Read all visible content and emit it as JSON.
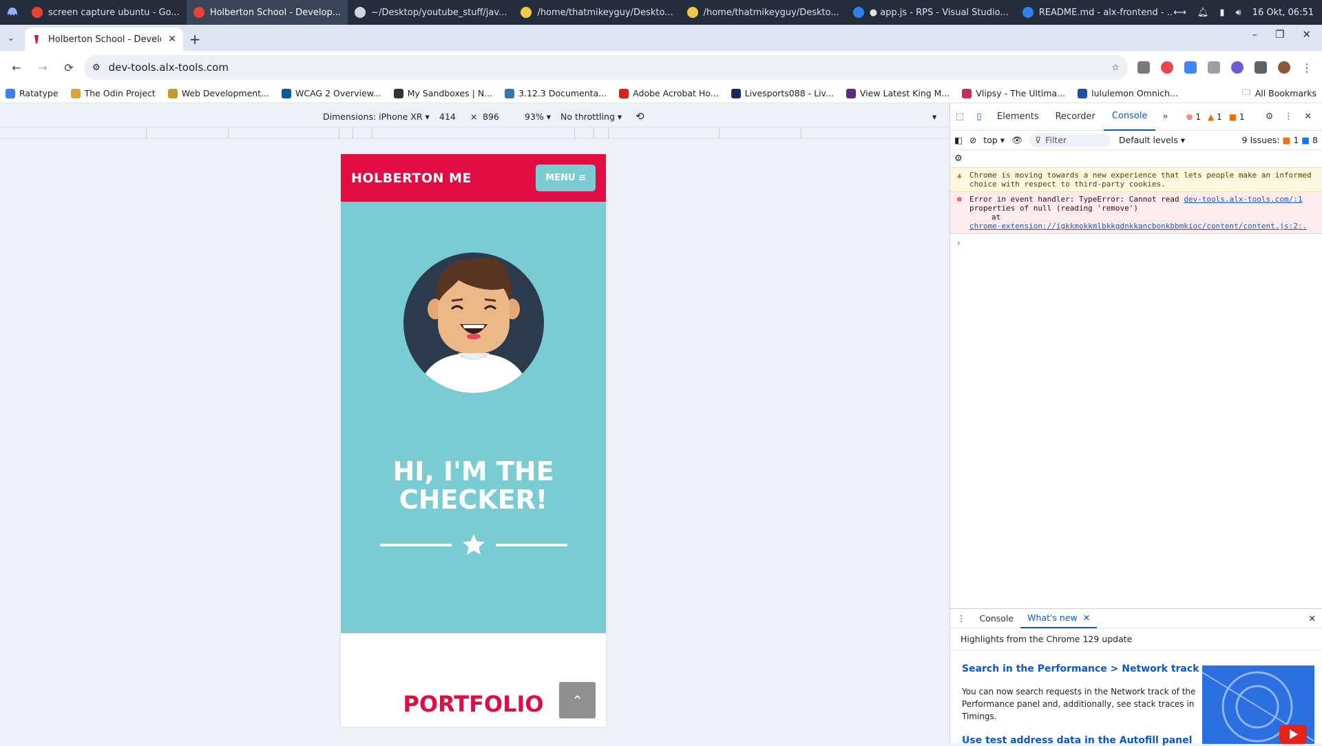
{
  "os": {
    "tasks": [
      {
        "label": "screen capture ubuntu - Go...",
        "color": "#ea4335",
        "active": false
      },
      {
        "label": "Holberton School - Develop...",
        "color": "#ea4335",
        "active": true
      },
      {
        "label": "~/Desktop/youtube_stuff/jav...",
        "color": "#cfd6e0",
        "active": false
      },
      {
        "label": "/home/thatmikeyguy/Deskto...",
        "color": "#f2c94c",
        "active": false
      },
      {
        "label": "/home/thatmikeyguy/Deskto...",
        "color": "#f2c94c",
        "active": false
      },
      {
        "label": "● app.js - RPS - Visual Studio...",
        "color": "#2f80ed",
        "active": false
      },
      {
        "label": "README.md - alx-frontend - ...",
        "color": "#2f80ed",
        "active": false
      }
    ],
    "clock": "16 Okt, 06:51"
  },
  "browser": {
    "tab_title": "Holberton School - Developer",
    "url": "dev-tools.alx-tools.com",
    "bookmarks": [
      {
        "label": "Ratatype",
        "color": "#3b82f6"
      },
      {
        "label": "The Odin Project",
        "color": "#d9a441"
      },
      {
        "label": "Web Development...",
        "color": "#c29b2e"
      },
      {
        "label": "WCAG 2 Overview...",
        "color": "#0a5aa0"
      },
      {
        "label": "My Sandboxes | N...",
        "color": "#333333"
      },
      {
        "label": "3.12.3 Documenta...",
        "color": "#3776ab"
      },
      {
        "label": "Adobe Acrobat Ho...",
        "color": "#d4251c"
      },
      {
        "label": "Livesports088 - Liv...",
        "color": "#1b2a5a"
      },
      {
        "label": "View Latest King M...",
        "color": "#5a2b8a"
      },
      {
        "label": "Vlipsy - The Ultima...",
        "color": "#c0305a"
      },
      {
        "label": "lululemon Omnich...",
        "color": "#1d4fa3"
      }
    ],
    "all_bookmarks": "All Bookmarks"
  },
  "device_toolbar": {
    "dimensions": "Dimensions: iPhone XR",
    "width": "414",
    "times": "×",
    "height": "896",
    "zoom": "93%",
    "throttling": "No throttling"
  },
  "site": {
    "logo": "HOLBERTON ME",
    "menu": "MENU ≡",
    "hero_line1": "HI, I'M THE",
    "hero_line2": "CHECKER!",
    "portfolio": "PORTFOLIO",
    "scroll_top": "⌃",
    "brand_red": "#e00c43",
    "teal": "#79cdd2"
  },
  "devtools": {
    "tabs": [
      "Elements",
      "Recorder",
      "Console"
    ],
    "active_tab": "Console",
    "counts": {
      "errors": "1",
      "warnings": "1",
      "info": "1"
    },
    "context": "top",
    "filter_placeholder": "Filter",
    "levels": "Default levels",
    "issues_label": "9 Issues:",
    "issues_a": "1",
    "issues_b": "8",
    "warning_text": "Chrome is moving towards a new experience that lets people make an informed choice with respect to third-party cookies.",
    "error_line1": "Error in event handler: TypeError: Cannot read",
    "error_link1": "dev-tools.alx-tools.com/:1",
    "error_line2": "properties of null (reading 'remove')",
    "error_line3": "at",
    "error_link2": "chrome-extension://igkkmokkmlbkkgdnkkancbonkbbmkioc/content/content.js:2:...",
    "drawer_tabs": [
      "Console",
      "What's new"
    ],
    "whats_new_headline": "Highlights from the Chrome 129 update",
    "news1_title": "Search in the Performance > Network track",
    "news1_body": "You can now search requests in the Network track of the Performance panel and, additionally, see stack traces in Timings.",
    "news2_title": "Use test address data in the Autofill panel"
  }
}
